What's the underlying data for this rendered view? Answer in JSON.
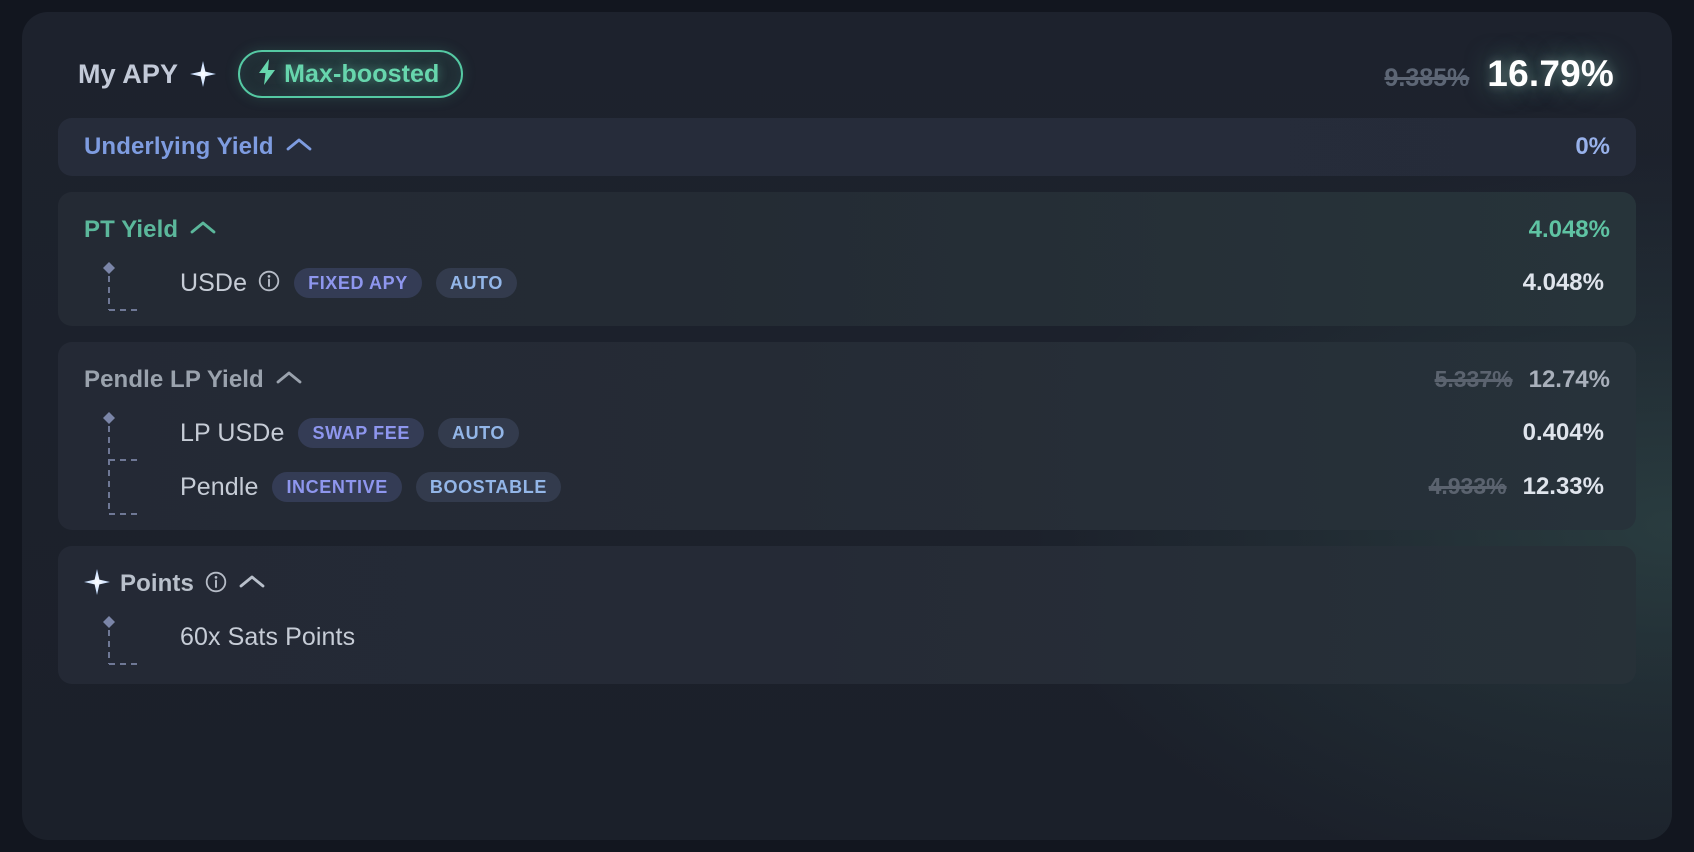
{
  "header": {
    "title": "My APY",
    "sparkle_icon": "sparkle-icon",
    "boost_badge": {
      "label": "Max-boosted",
      "icon": "lightning-bolt-icon"
    },
    "old_value": "9.385%",
    "value": "16.79%"
  },
  "sections": [
    {
      "id": "underlying-yield",
      "title": "Underlying Yield",
      "chevron": "chevron-up-icon",
      "value": "0%",
      "old_value": "",
      "rows": []
    },
    {
      "id": "pt-yield",
      "title": "PT Yield",
      "chevron": "chevron-up-icon",
      "value": "4.048%",
      "old_value": "",
      "rows": [
        {
          "name": "USDe",
          "info_icon": "info-icon",
          "badges": [
            {
              "label": "FIXED APY",
              "style": "purple"
            },
            {
              "label": "AUTO",
              "style": "blue"
            }
          ],
          "old_value": "",
          "value": "4.048%"
        }
      ]
    },
    {
      "id": "pendle-lp-yield",
      "title": "Pendle LP Yield",
      "chevron": "chevron-up-icon",
      "old_value": "5.337%",
      "value": "12.74%",
      "rows": [
        {
          "name": "LP USDe",
          "info_icon": "",
          "badges": [
            {
              "label": "SWAP FEE",
              "style": "purple"
            },
            {
              "label": "AUTO",
              "style": "blue"
            }
          ],
          "old_value": "",
          "value": "0.404%"
        },
        {
          "name": "Pendle",
          "info_icon": "",
          "badges": [
            {
              "label": "INCENTIVE",
              "style": "purple"
            },
            {
              "label": "BOOSTABLE",
              "style": "blue"
            }
          ],
          "old_value": "4.933%",
          "value": "12.33%"
        }
      ]
    },
    {
      "id": "points",
      "title": "Points",
      "leading_icon": "sparkle-icon",
      "info_icon": "info-icon",
      "chevron": "chevron-up-icon",
      "old_value": "",
      "value": "",
      "rows": [
        {
          "name": "60x Sats Points",
          "info_icon": "",
          "badges": [],
          "old_value": "",
          "value": ""
        }
      ]
    }
  ],
  "colors": {
    "accent_green": "#67d6ad",
    "accent_blue": "#7e9ce0",
    "badge_purple_text": "#8e96ee",
    "badge_blue_text": "#93b6e8",
    "card_bg": "#1d222d"
  }
}
